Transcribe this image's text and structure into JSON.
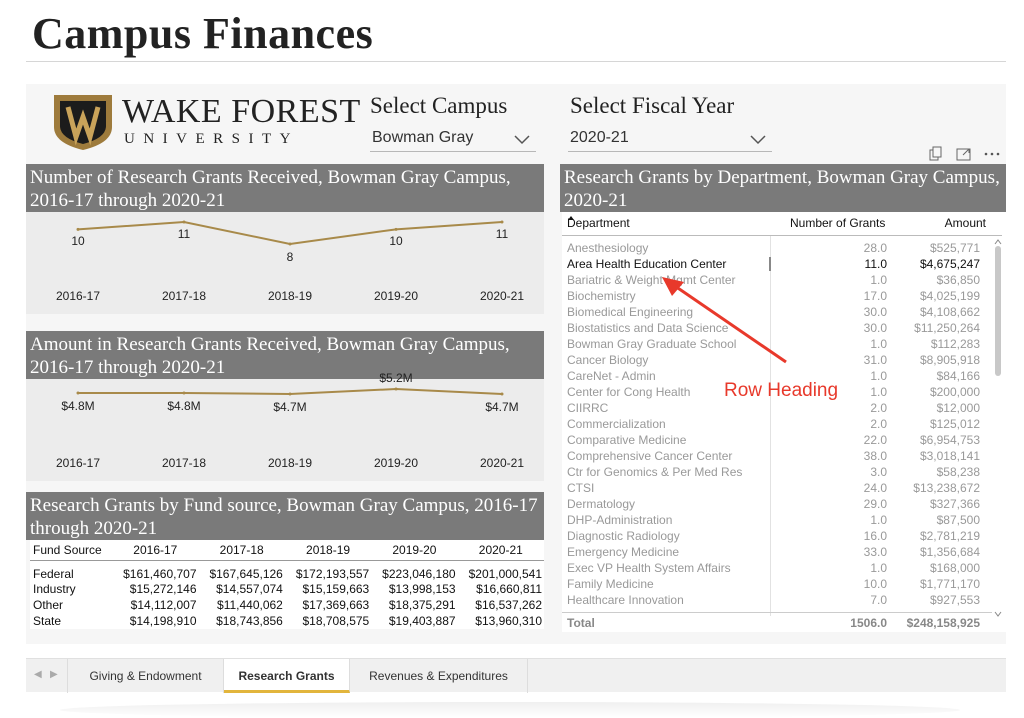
{
  "page": {
    "title": "Campus Finances"
  },
  "logo": {
    "name": "WAKE FOREST",
    "sub": "UNIVERSITY"
  },
  "campus_slicer": {
    "title": "Select Campus",
    "value": "Bowman Gray"
  },
  "year_slicer": {
    "title": "Select Fiscal Year",
    "value": "2020-21"
  },
  "grants_count": {
    "title": "Number of Research Grants Received, Bowman Gray Campus, 2016-17 through 2020-21",
    "labels": [
      "10",
      "11",
      "8",
      "10",
      "11"
    ]
  },
  "grants_amount": {
    "title": "Amount in Research Grants Received, Bowman Gray Campus, 2016-17 through 2020-21",
    "labels": [
      "$4.8M",
      "$4.8M",
      "$4.7M",
      "$5.2M",
      "$4.7M"
    ]
  },
  "chart_data": [
    {
      "type": "line",
      "title": "Number of Research Grants Received, Bowman Gray Campus, 2016-17 through 2020-21",
      "categories": [
        "2016-17",
        "2017-18",
        "2018-19",
        "2019-20",
        "2020-21"
      ],
      "values": [
        10,
        11,
        8,
        10,
        11
      ],
      "color": "#a88a4a"
    },
    {
      "type": "line",
      "title": "Amount in Research Grants Received, Bowman Gray Campus, 2016-17 through 2020-21",
      "categories": [
        "2016-17",
        "2017-18",
        "2018-19",
        "2019-20",
        "2020-21"
      ],
      "values": [
        4.8,
        4.8,
        4.7,
        5.2,
        4.7
      ],
      "color": "#a88a4a"
    }
  ],
  "fund_source": {
    "title": "Research Grants by Fund source, Bowman Gray Campus, 2016-17 through 2020-21",
    "headers": [
      "Fund Source",
      "2016-17",
      "2017-18",
      "2018-19",
      "2019-20",
      "2020-21"
    ],
    "rows": [
      [
        "Federal",
        "$161,460,707",
        "$167,645,126",
        "$172,193,557",
        "$223,046,180",
        "$201,000,541"
      ],
      [
        "Industry",
        "$15,272,146",
        "$14,557,074",
        "$15,159,663",
        "$13,998,153",
        "$16,660,811"
      ],
      [
        "Other",
        "$14,112,007",
        "$11,440,062",
        "$17,369,663",
        "$18,375,291",
        "$16,537,262"
      ],
      [
        "State",
        "$14,198,910",
        "$18,743,856",
        "$18,708,575",
        "$19,403,887",
        "$13,960,310"
      ]
    ]
  },
  "departments": {
    "title": "Research Grants by Department, Bowman Gray Campus, 2020-21",
    "headers": [
      "Department",
      "Number of Grants",
      "Amount"
    ],
    "rows": [
      [
        "Anesthesiology",
        "28.0",
        "$525,771"
      ],
      [
        "Area Health Education Center",
        "11.0",
        "$4,675,247"
      ],
      [
        "Bariatric & Weight Mgmt Center",
        "1.0",
        "$36,850"
      ],
      [
        "Biochemistry",
        "17.0",
        "$4,025,199"
      ],
      [
        "Biomedical Engineering",
        "30.0",
        "$4,108,662"
      ],
      [
        "Biostatistics and Data Science",
        "30.0",
        "$11,250,264"
      ],
      [
        "Bowman Gray Graduate School",
        "1.0",
        "$112,283"
      ],
      [
        "Cancer Biology",
        "31.0",
        "$8,905,918"
      ],
      [
        "CareNet - Admin",
        "1.0",
        "$84,166"
      ],
      [
        "Center for Cong Health",
        "1.0",
        "$200,000"
      ],
      [
        "CIIRRC",
        "2.0",
        "$12,000"
      ],
      [
        "Commercialization",
        "2.0",
        "$125,012"
      ],
      [
        "Comparative Medicine",
        "22.0",
        "$6,954,753"
      ],
      [
        "Comprehensive Cancer Center",
        "38.0",
        "$3,018,141"
      ],
      [
        "Ctr for Genomics & Per Med Res",
        "3.0",
        "$58,238"
      ],
      [
        "CTSI",
        "24.0",
        "$13,238,672"
      ],
      [
        "Dermatology",
        "29.0",
        "$327,366"
      ],
      [
        "DHP-Administration",
        "1.0",
        "$87,500"
      ],
      [
        "Diagnostic Radiology",
        "16.0",
        "$2,781,219"
      ],
      [
        "Emergency Medicine",
        "33.0",
        "$1,356,684"
      ],
      [
        "Exec VP Health System Affairs",
        "1.0",
        "$168,000"
      ],
      [
        "Family Medicine",
        "10.0",
        "$1,771,170"
      ],
      [
        "Healthcare Innovation",
        "7.0",
        "$927,553"
      ]
    ],
    "total": [
      "Total",
      "1506.0",
      "$248,158,925"
    ]
  },
  "annotation": "Row Heading",
  "tabs": [
    "Giving & Endowment",
    "Research Grants",
    "Revenues & Expenditures"
  ]
}
